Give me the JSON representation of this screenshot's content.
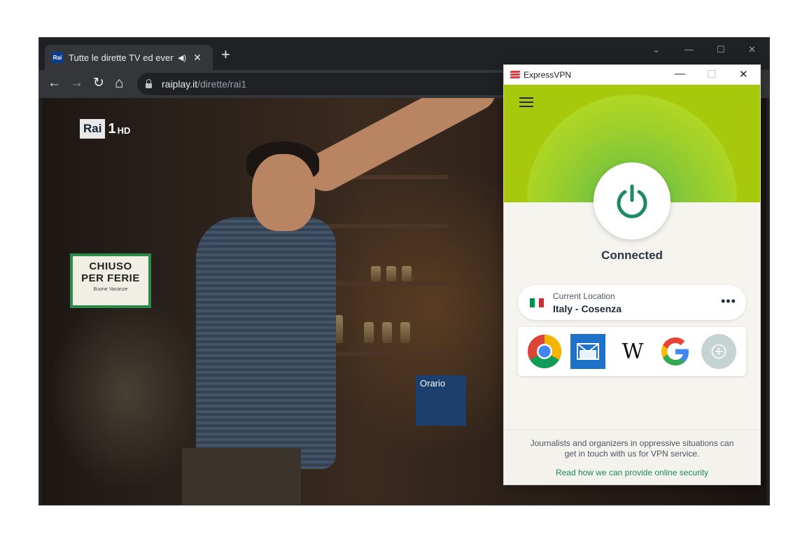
{
  "browser": {
    "tab": {
      "title": "Tutte le dirette TV ed eventi",
      "favicon_text": "Rai",
      "audio_icon": "speaker-icon",
      "close_icon": "close-icon"
    },
    "new_tab_icon": "plus-icon",
    "nav": {
      "back": "←",
      "forward": "→",
      "reload": "↻",
      "home": "⌂"
    },
    "url": {
      "host": "raiplay.it",
      "path": "/dirette/rai1"
    },
    "window_controls": [
      "chevron-down-icon",
      "minimize-icon",
      "maximize-icon",
      "close-icon"
    ]
  },
  "video": {
    "channel_logo": {
      "brand": "Rai",
      "number": "1",
      "quality": "HD"
    },
    "sign": {
      "line1": "CHIUSO",
      "line2": "PER FERIE",
      "line3": "Buone Vacanze"
    },
    "store_hours_label": "Orario"
  },
  "vpn": {
    "app_title": "ExpressVPN",
    "status": "Connected",
    "location": {
      "label": "Current Location",
      "value": "Italy - Cosenza",
      "flag_colors": [
        "#009246",
        "#ffffff",
        "#ce2b37"
      ]
    },
    "shortcuts": [
      {
        "name": "chrome-icon"
      },
      {
        "name": "mail-icon"
      },
      {
        "name": "wikipedia-icon",
        "glyph": "W"
      },
      {
        "name": "google-icon"
      },
      {
        "name": "add-shortcut-icon"
      }
    ],
    "footer": {
      "text": "Journalists and organizers in oppressive situations can get in touch with us for VPN service.",
      "link": "Read how we can provide online security"
    },
    "colors": {
      "brand_red": "#da3940",
      "hero_green": "#a7c80b",
      "power_green": "#1d8a66",
      "link_green": "#1a8a59"
    }
  }
}
